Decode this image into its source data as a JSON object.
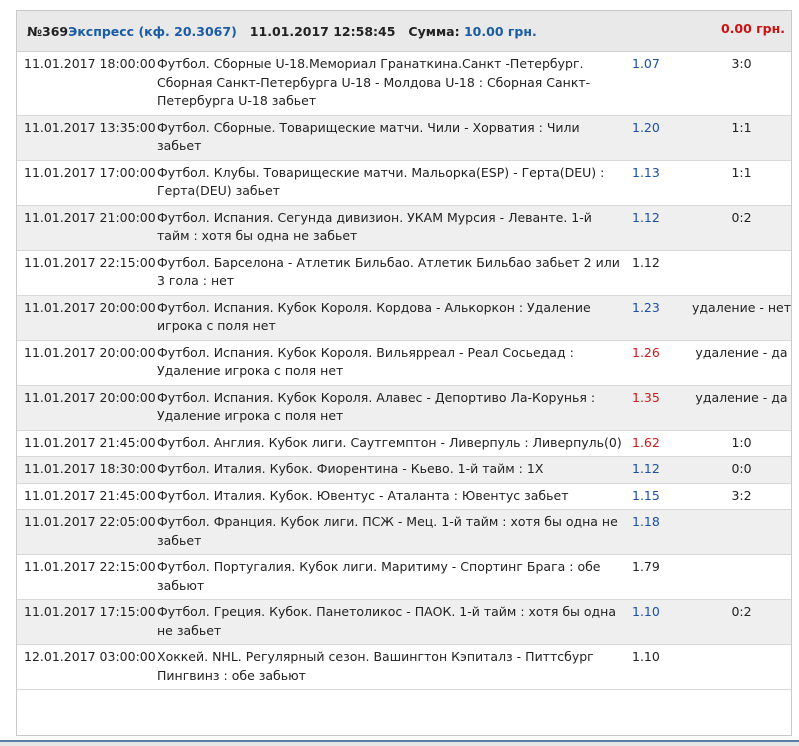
{
  "header": {
    "number": "№369",
    "type": "Экспресс (кф. 20.3067)",
    "datetime": "11.01.2017 12:58:45",
    "sum_label": "Сумма:",
    "sum_value": "10.00 грн.",
    "total": "0.00 грн."
  },
  "bets": [
    {
      "dt": "11.01.2017 18:00:00",
      "event": "Футбол. Сборные U-18.Мемориал Гранаткина.Санкт -Петербург. Сборная Санкт-Петербурга U-18 - Молдова U-18 : Сборная Санкт-Петербурга U-18 забьет",
      "coef": "1.07",
      "coef_color": "blue",
      "result": "3:0"
    },
    {
      "dt": "11.01.2017 13:35:00",
      "event": "Футбол. Сборные. Товарищеские матчи. Чили - Хорватия : Чили забьет",
      "coef": "1.20",
      "coef_color": "blue",
      "result": "1:1"
    },
    {
      "dt": "11.01.2017 17:00:00",
      "event": "Футбол. Клубы. Товарищеские матчи. Мальорка(ESP) - Герта(DEU) : Герта(DEU) забьет",
      "coef": "1.13",
      "coef_color": "blue",
      "result": "1:1"
    },
    {
      "dt": "11.01.2017 21:00:00",
      "event": "Футбол. Испания. Сегунда дивизион. УКАМ Мурсия - Леванте. 1-й тайм : хотя бы одна не забьет",
      "coef": "1.12",
      "coef_color": "blue",
      "result": "0:2"
    },
    {
      "dt": "11.01.2017 22:15:00",
      "event": "Футбол. Барселона - Атлетик Бильбао. Атлетик Бильбао забьет 2 или 3 гола : нет",
      "coef": "1.12",
      "coef_color": "dark",
      "result": ""
    },
    {
      "dt": "11.01.2017 20:00:00",
      "event": "Футбол. Испания. Кубок Короля. Кордова - Алькоркон : Удаление игрока с поля нет",
      "coef": "1.23",
      "coef_color": "blue",
      "result": "удаление - нет"
    },
    {
      "dt": "11.01.2017 20:00:00",
      "event": "Футбол. Испания. Кубок Короля. Вильярреал - Реал Сосьедад : Удаление игрока с поля нет",
      "coef": "1.26",
      "coef_color": "red",
      "result": "удаление - да"
    },
    {
      "dt": "11.01.2017 20:00:00",
      "event": "Футбол. Испания. Кубок Короля. Алавес - Депортиво Ла-Корунья : Удаление игрока с поля нет",
      "coef": "1.35",
      "coef_color": "red",
      "result": "удаление - да"
    },
    {
      "dt": "11.01.2017 21:45:00",
      "event": "Футбол. Англия. Кубок лиги. Саутгемптон - Ливерпуль : Ливерпуль(0)",
      "coef": "1.62",
      "coef_color": "red",
      "result": "1:0"
    },
    {
      "dt": "11.01.2017 18:30:00",
      "event": "Футбол. Италия. Кубок. Фиорентина - Кьево. 1-й тайм : 1X",
      "coef": "1.12",
      "coef_color": "blue",
      "result": "0:0"
    },
    {
      "dt": "11.01.2017 21:45:00",
      "event": "Футбол. Италия. Кубок. Ювентус - Аталанта : Ювентус забьет",
      "coef": "1.15",
      "coef_color": "blue",
      "result": "3:2"
    },
    {
      "dt": "11.01.2017 22:05:00",
      "event": "Футбол. Франция. Кубок лиги. ПСЖ - Мец. 1-й тайм : хотя бы одна не забьет",
      "coef": "1.18",
      "coef_color": "blue",
      "result": ""
    },
    {
      "dt": "11.01.2017 22:15:00",
      "event": "Футбол. Португалия. Кубок лиги. Маритиму - Спортинг Брага : обе забьют",
      "coef": "1.79",
      "coef_color": "dark",
      "result": ""
    },
    {
      "dt": "11.01.2017 17:15:00",
      "event": "Футбол. Греция. Кубок. Панетоликос - ПАОК. 1-й тайм : хотя бы одна не забьет",
      "coef": "1.10",
      "coef_color": "blue",
      "result": "0:2"
    },
    {
      "dt": "12.01.2017 03:00:00",
      "event": "Хоккей. NHL. Регулярный сезон. Вашингтон Кэпиталз - Питтсбург Пингвинз : обе забьют",
      "coef": "1.10",
      "coef_color": "dark",
      "result": ""
    }
  ]
}
